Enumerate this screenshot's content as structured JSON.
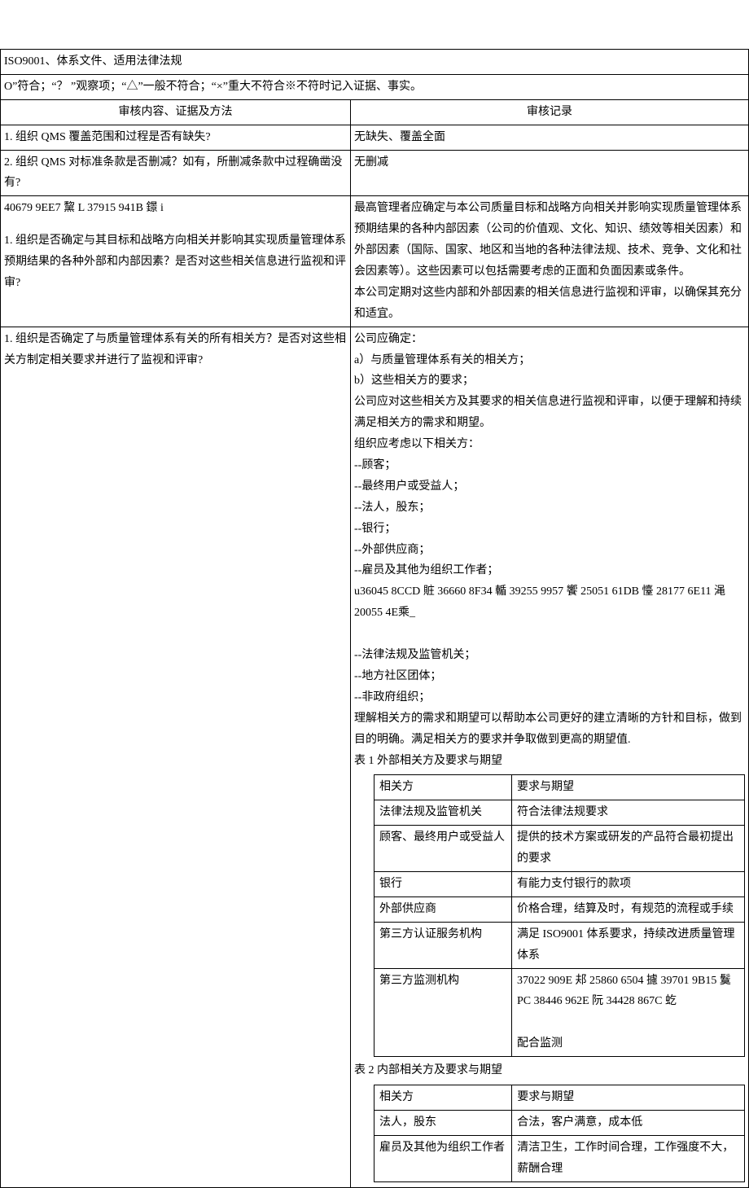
{
  "header_line1": "ISO9001、体系文件、适用法律法规",
  "header_line2": "O”符合；“？ ”观察项；“△”一般不符合；“×”重大不符合※不符时记入证据、事实。",
  "col_left_header": "审核内容、证据及方法",
  "col_right_header": "审核记录",
  "rows": {
    "r1_left": "1. 组织 QMS 覆盖范围和过程是否有缺失?",
    "r1_right": "无缺失、覆盖全面",
    "r2_left": "2. 组织 QMS 对标准条款是否删减？如有，所删减条款中过程确凿没有?",
    "r2_right": "无删减",
    "r3_left_a": " 40679 9EE7 黧   L  37915 941B 鐛 i",
    "r3_left_b": "1. 组织是否确定与其目标和战略方向相关并影响其实现质量管理体系预期结果的各种外部和内部因素？是否对这些相关信息进行监视和评审?",
    "r3_right": "最高管理者应确定与本公司质量目标和战略方向相关并影响实现质量管理体系预期结果的各种内部因素（公司的价值观、文化、知识、绩效等相关因素）和外部因素（国际、国家、地区和当地的各种法律法规、技术、竞争、文化和社会因素等）。这些因素可以包括需要考虑的正面和负面因素或条件。\n本公司定期对这些内部和外部因素的相关信息进行监视和评审，以确保其充分和适宜。",
    "r4_left": "1. 组织是否确定了与质量管理体系有关的所有相关方？是否对这些相关方制定相关要求并进行了监视和评审?",
    "r4_right_lines": [
      "公司应确定：",
      "a）与质量管理体系有关的相关方；",
      "b）这些相关方的要求；",
      "公司应对这些相关方及其要求的相关信息进行监视和评审，以便于理解和持续满足相关方的需求和期望。",
      "组织应考虑以下相关方：",
      "--顾客；",
      "--最终用户或受益人；",
      "--法人，股东；",
      "--银行；",
      "--外部供应商；",
      "--雇员及其他为组织工作者；",
      "u36045 8CCD 賍 36660 8F34 輴 39255 9957 饗 25051 61DB 懛 28177 6E11 渑 20055 4E乘_",
      "",
      "--法律法规及监管机关；",
      "--地方社区团体；",
      "--非政府组织；",
      "理解相关方的需求和期望可以帮助本公司更好的建立清晰的方针和目标，做到目的明确。满足相关方的要求并争取做到更高的期望值."
    ],
    "table1_caption": "表 1 外部相关方及要求与期望",
    "table1_h1": "相关方",
    "table1_h2": "要求与期望",
    "table1_rows": [
      [
        "法律法规及监管机关",
        "符合法律法规要求"
      ],
      [
        "顾客、最终用户或受益人",
        "提供的技术方案或研发的产品符合最初提出的要求"
      ],
      [
        "银行",
        "有能力支付银行的款项"
      ],
      [
        "外部供应商",
        "价格合理，结算及时，有规范的流程或手续"
      ],
      [
        "第三方认证服务机构",
        "满足 ISO9001 体系要求，持续改进质量管理体系"
      ],
      [
        "第三方监测机构",
        "37022  909E  邞 25860  6504  攄 39701  9B15  鬕PC  38446 962E 阮 34428 867C 虼\n\n配合监测"
      ]
    ],
    "table2_caption": "表 2 内部相关方及要求与期望",
    "table2_h1": "相关方",
    "table2_h2": "要求与期望",
    "table2_rows": [
      [
        "法人，股东",
        "合法，客户满意，成本低"
      ],
      [
        "雇员及其他为组织工作者",
        "清洁卫生，工作时间合理，工作强度不大，薪酬合理"
      ]
    ]
  }
}
